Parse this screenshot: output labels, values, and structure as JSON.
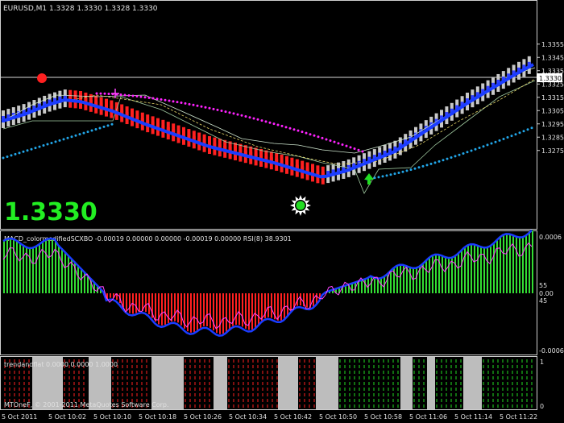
{
  "window": {
    "symbol_title": "EURUSD,M1  1.3328 1.3330 1.3328 1.3330",
    "big_price": "1.3330",
    "current_price_tag": "1.3330",
    "watermark": "MTOneF, © 2001-2011 MetaQuotes Software Corp."
  },
  "price_panel": {
    "axis_labels": [
      "1.3355",
      "1.3345",
      "1.3335",
      "1.3325",
      "1.3315",
      "1.3305",
      "1.3295",
      "1.3285",
      "1.3275"
    ],
    "axis_values": [
      1.3355,
      1.3345,
      1.3335,
      1.3325,
      1.3315,
      1.3305,
      1.3295,
      1.3285,
      1.3275
    ],
    "current_price": 1.333
  },
  "macd_panel": {
    "title": "MACD_colormodifiedSCXBO -0.00019 0.00000 0.00000 -0.00019 0.00000  RSI(8) 38.9301",
    "axis_labels": [
      "0.0006",
      "55",
      "0.00",
      "45",
      "-0.0006"
    ]
  },
  "trend_panel": {
    "title": "trendandflat 0.0000 0.0000 1.0000",
    "axis_labels": [
      "1",
      "0"
    ]
  },
  "time_axis": {
    "labels": [
      "5 Oct 2011",
      "5 Oct 10:02",
      "5 Oct 10:10",
      "5 Oct 10:18",
      "5 Oct 10:26",
      "5 Oct 10:34",
      "5 Oct 10:42",
      "5 Oct 10:50",
      "5 Oct 10:58",
      "5 Oct 11:06",
      "5 Oct 11:14",
      "5 Oct 11:22"
    ]
  },
  "colors": {
    "background": "#000000",
    "bull_candle": "#c8c8c8",
    "bear_candle": "#ff2020",
    "ma_line": "#1a3cff",
    "upper_dots": "#ff22ff",
    "lower_dots": "#22a6e8",
    "hist_positive": "#33dd33",
    "hist_negative": "#ff2020",
    "rsi_line": "#ff44ff",
    "big_price": "#22ee22",
    "trend_green": "#22dd22",
    "trend_red": "#ff2020",
    "flat_grey": "#bdbdbd"
  },
  "icons": {
    "sell_marker": "red-dot-icon",
    "buy_marker": "green-up-arrow-icon",
    "signal_marker": "sun-icon",
    "cross_marker": "magenta-cross-icon"
  }
}
